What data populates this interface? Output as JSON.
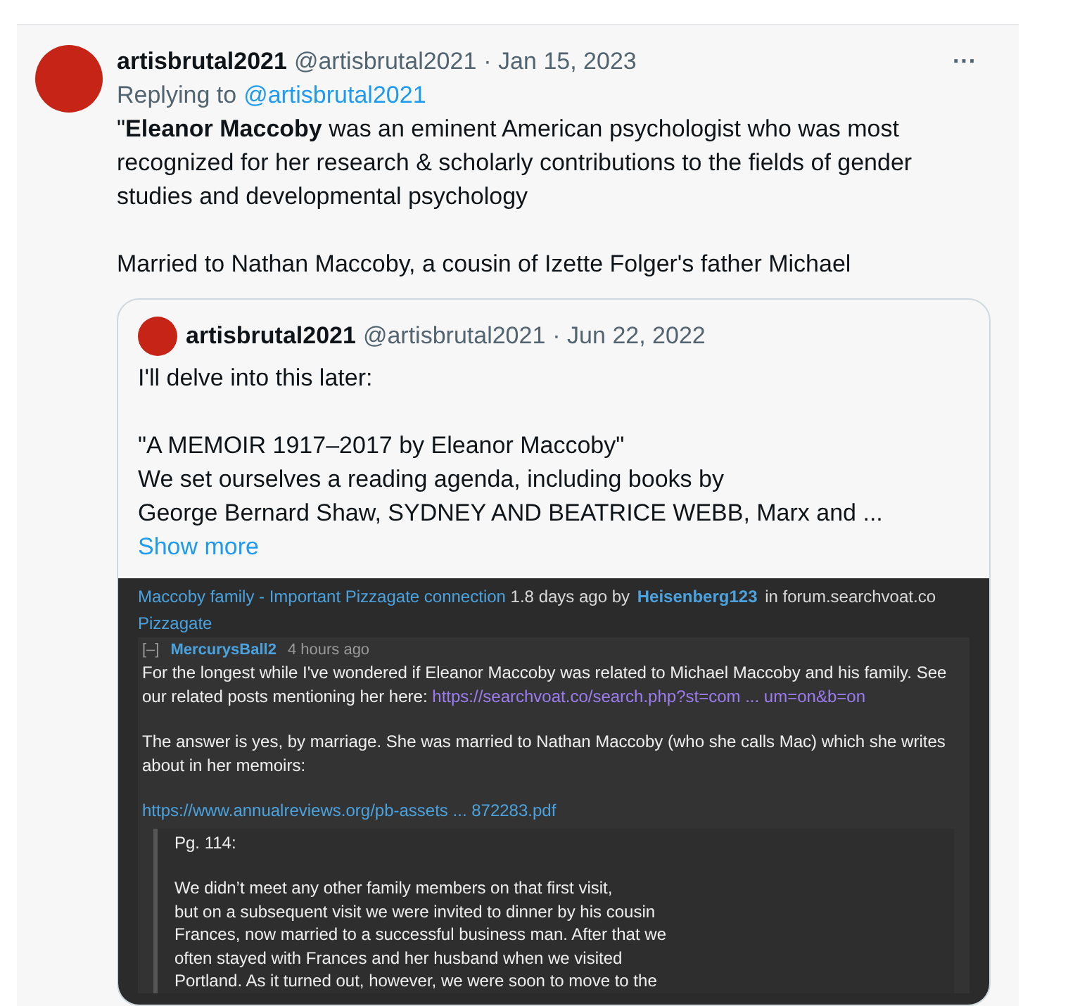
{
  "tweet": {
    "author": "artisbrutal2021",
    "handle": "@artisbrutal2021",
    "date": "· Jan 15, 2023",
    "more": "···",
    "replying_label": "Replying to",
    "replying_handle": "@artisbrutal2021",
    "paragraphs": [
      "\"**Eleanor Maccoby** was an eminent American psychologist who was most recognized for her research & scholarly contributions to the fields of gender studies and developmental psychology",
      "Married to Nathan Maccoby, a cousin of Izette Folger's father Michael"
    ]
  },
  "quote": {
    "author": "artisbrutal2021",
    "handle": "@artisbrutal2021",
    "date": "· Jun 22, 2022",
    "paragraphs": [
      [
        "I'll delve into this later:"
      ],
      [
        "\"A MEMOIR 1917–2017 by Eleanor Maccoby\"",
        "We set ourselves a reading agenda, including books by",
        "George Bernard Shaw, SYDNEY AND BEATRICE WEBB, Marx and ..."
      ]
    ],
    "show_more": "Show more"
  },
  "screenshot": {
    "title_link": "Maccoby family - Important Pizzagate connection",
    "meta": "1.8 days ago by",
    "poster": "Heisenberg123",
    "forum": "in forum.searchvoat.co",
    "category": "Pizzagate",
    "comment": {
      "toggle": "[–]",
      "user": "MercurysBall2",
      "time": "4 hours ago",
      "paragraph_1_text": "For the longest while I've wondered if Eleanor Maccoby was related to Michael Maccoby and his family. See our related posts mentioning her here:",
      "paragraph_1_link": "https://searchvoat.co/search.php?st=com ... um=on&b=on",
      "paragraph_2": "The answer is yes, by marriage. She was married to Nathan Maccoby (who she calls Mac) which she writes about in her memoirs:",
      "pdf_link": "https://www.annualreviews.org/pb-assets ... 872283.pdf",
      "excerpt_heading": "Pg. 114:",
      "excerpt_lines": [
        "We didn’t meet any other family members on that first visit,",
        "but on a subsequent visit we were invited to dinner by his cousin",
        "Frances, now married to a successful business man. After that we",
        "often stayed with Frances and her husband when we visited",
        "Portland. As it turned out, however, we were soon to move to the"
      ]
    }
  }
}
